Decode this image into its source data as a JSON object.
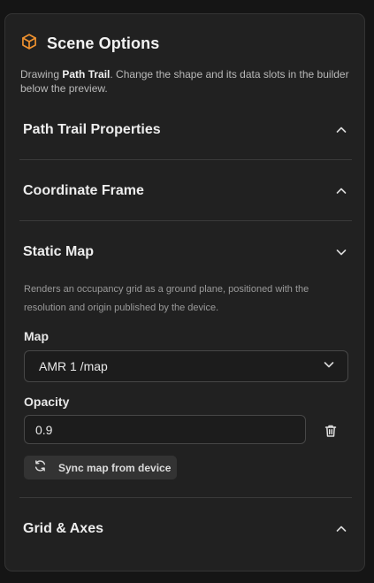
{
  "panel": {
    "title": "Scene Options",
    "accent_color": "#f0922f",
    "description": {
      "prefix": "Drawing ",
      "bold": "Path Trail",
      "suffix": ". Change the shape and its data slots in the builder below the preview."
    }
  },
  "sections": [
    {
      "label": "Path Trail Properties",
      "state": "collapsed",
      "chevron": "chevron-up-icon"
    },
    {
      "label": "Coordinate Frame",
      "state": "collapsed",
      "chevron": "chevron-up-icon"
    },
    {
      "label": "Static Map",
      "state": "expanded",
      "chevron": "chevron-down-icon"
    },
    {
      "label": "Grid & Axes",
      "state": "collapsed",
      "chevron": "chevron-up-icon"
    }
  ],
  "static_map": {
    "description": "Renders an occupancy grid as a ground plane, positioned with the resolution and origin published by the device.",
    "map_label": "Map",
    "map_value": "AMR 1 /map",
    "opacity_label": "Opacity",
    "opacity_value": "0.9",
    "sync_button": "Sync map from device"
  }
}
